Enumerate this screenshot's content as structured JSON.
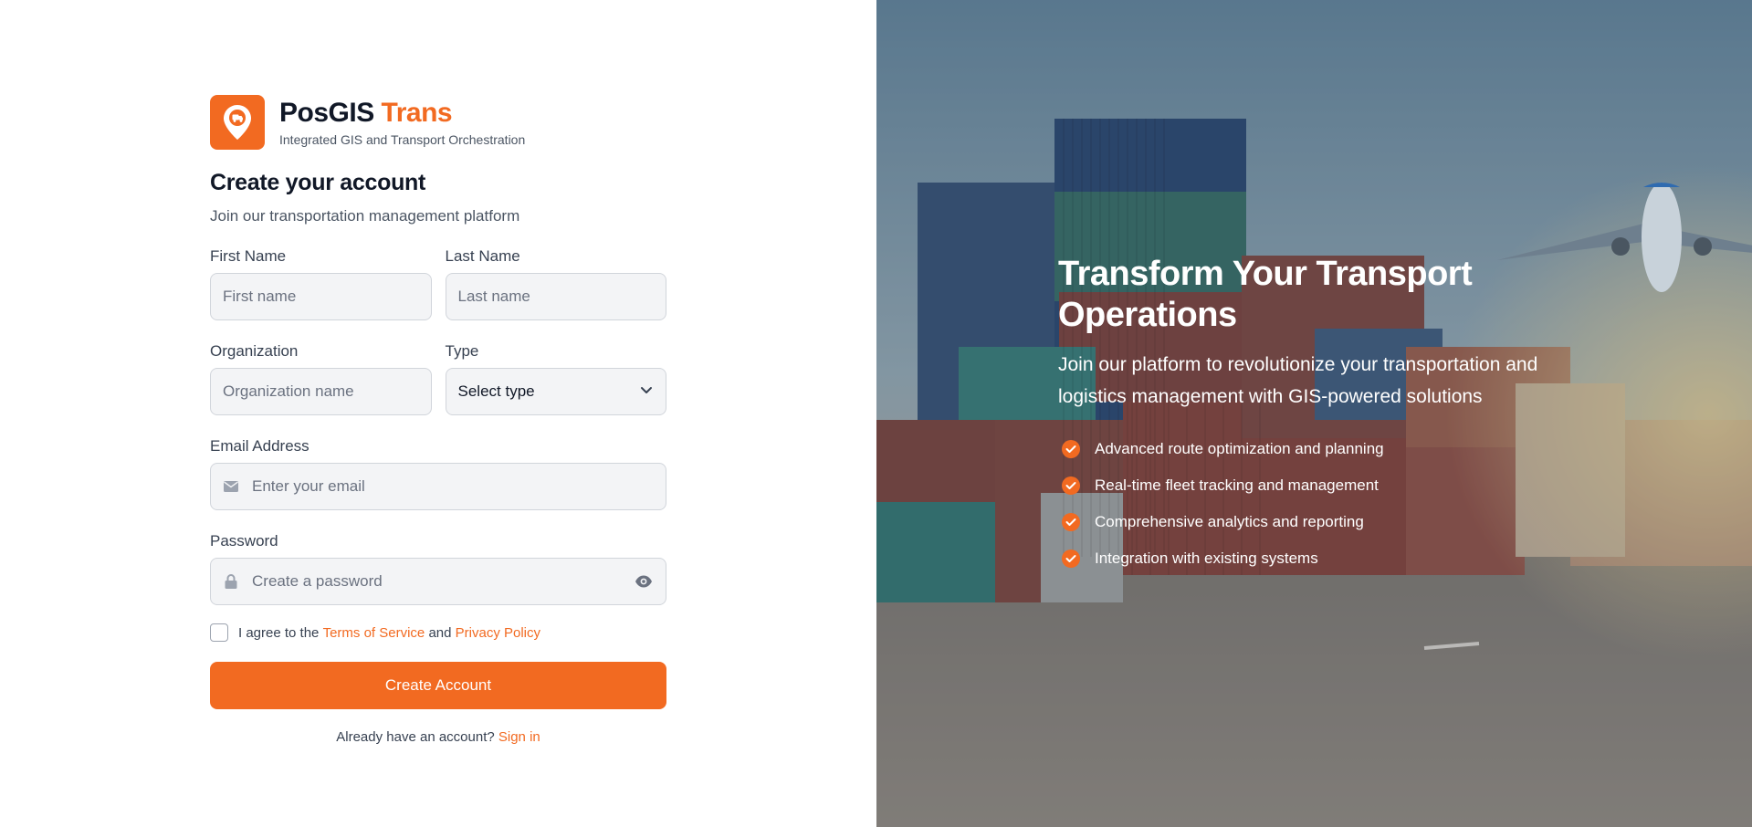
{
  "brand": {
    "name_main": "PosGIS",
    "name_accent": "Trans",
    "tagline": "Integrated GIS and Transport Orchestration"
  },
  "form": {
    "title": "Create your account",
    "subtitle": "Join our transportation management platform",
    "first_name": {
      "label": "First Name",
      "placeholder": "First name",
      "value": ""
    },
    "last_name": {
      "label": "Last Name",
      "placeholder": "Last name",
      "value": ""
    },
    "organization": {
      "label": "Organization",
      "placeholder": "Organization name",
      "value": ""
    },
    "type": {
      "label": "Type",
      "selected": "Select type"
    },
    "email": {
      "label": "Email Address",
      "placeholder": "Enter your email",
      "value": ""
    },
    "password": {
      "label": "Password",
      "placeholder": "Create a password",
      "value": ""
    },
    "agree": {
      "prefix": "I agree to the ",
      "terms": "Terms of Service",
      "and": " and ",
      "privacy": "Privacy Policy",
      "checked": false
    },
    "submit_label": "Create Account",
    "signin_prompt": "Already have an account?",
    "signin_link": "Sign in"
  },
  "hero": {
    "title": "Transform Your Transport Operations",
    "description": "Join our platform to revolutionize your transportation and logistics management with GIS-powered solutions",
    "features": [
      "Advanced route optimization and planning",
      "Real-time fleet tracking and management",
      "Comprehensive analytics and reporting",
      "Integration with existing systems"
    ]
  },
  "colors": {
    "accent": "#f26a21",
    "input_bg": "#f3f4f6",
    "text_dark": "#111827",
    "text_muted": "#4b5563"
  },
  "icons": {
    "logo": "map-pin-truck-icon",
    "email": "mail-icon",
    "password": "lock-icon",
    "reveal": "eye-icon",
    "select": "chevron-down-icon",
    "feature": "check-circle-icon"
  }
}
